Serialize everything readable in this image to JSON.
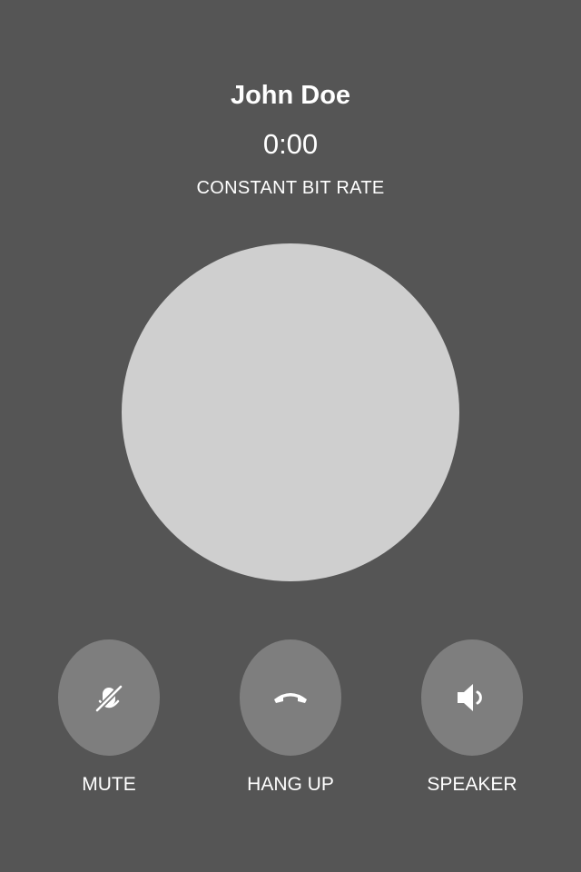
{
  "call": {
    "caller_name": "John Doe",
    "duration": "0:00",
    "codec_mode": "CONSTANT BIT RATE"
  },
  "controls": {
    "mute_label": "MUTE",
    "hangup_label": "HANG UP",
    "speaker_label": "SPEAKER",
    "mute_icon": "microphone-off-icon",
    "hangup_icon": "phone-hangup-icon",
    "speaker_icon": "speaker-icon"
  },
  "colors": {
    "background": "#555555",
    "avatar": "#cfcfcf",
    "button": "#7e7e7e",
    "text": "#ffffff"
  }
}
